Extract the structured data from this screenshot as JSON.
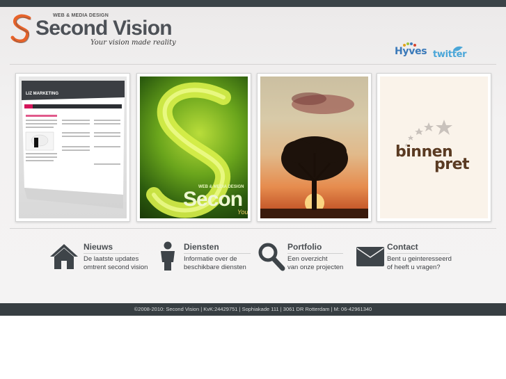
{
  "header": {
    "logo_small": "WEB & MEDIA DESIGN",
    "logo_name": "Second Vision",
    "logo_tagline": "Your vision made reality",
    "social": {
      "hyves": "Hyves",
      "twitter": "twitter"
    }
  },
  "portfolio_thumbs": [
    {
      "label": "LIZ MARKETING"
    },
    {
      "label_small": "WEB & MEDIA DESIGN",
      "label_big": "Secon",
      "label_tail": "You"
    },
    {
      "label": ""
    },
    {
      "line1": "binnen",
      "line2": "pret"
    }
  ],
  "nav": [
    {
      "title": "Nieuws",
      "desc1": "De laatste updates",
      "desc2": "omtrent second vision",
      "icon": "home-icon"
    },
    {
      "title": "Diensten",
      "desc1": "Informatie over de",
      "desc2": "beschikbare diensten",
      "icon": "person-icon"
    },
    {
      "title": "Portfolio",
      "desc1": "Een overzicht",
      "desc2": "van onze projecten",
      "icon": "magnifier-icon"
    },
    {
      "title": "Contact",
      "desc1": "Bent u geinteresseerd",
      "desc2": "of heeft u vragen?",
      "icon": "envelope-icon"
    }
  ],
  "footer": {
    "text": "©2008-2010: Second Vision | KvK:24429751 | Sophiakade 111 | 3061 DR Rotterdam | M: 06-42961340"
  },
  "colors": {
    "topbar": "#3b4448",
    "footer": "#373e42",
    "logo_accent": "#e8632a",
    "text_dark": "#4a4e52"
  }
}
